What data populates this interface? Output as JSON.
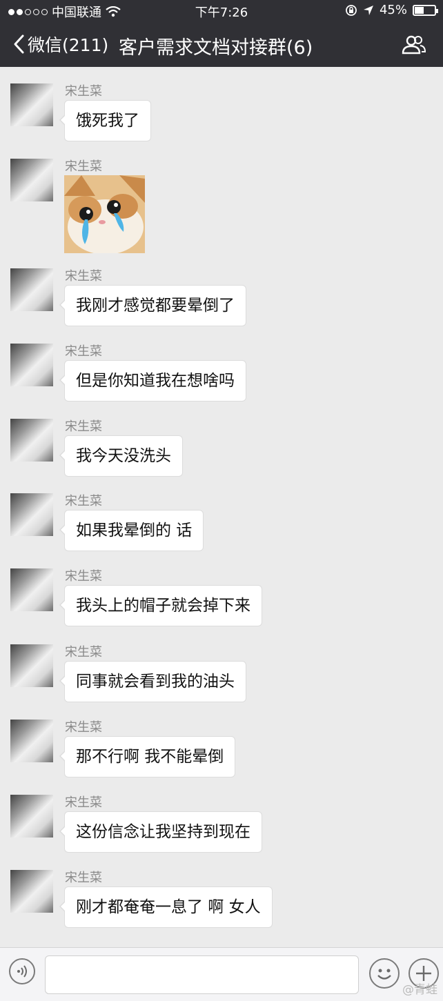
{
  "status_bar": {
    "carrier": "中国联通",
    "time": "下午7:26",
    "battery": "45%",
    "battery_level": 0.45
  },
  "nav": {
    "back_label": "微信(211)",
    "title": "客户需求文档对接群(6)"
  },
  "messages": [
    {
      "sender": "宋生菜",
      "text": "饿死我了"
    },
    {
      "sender": "宋生菜",
      "sticker": "crying-cat-sticker"
    },
    {
      "sender": "宋生菜",
      "text": "我刚才感觉都要晕倒了"
    },
    {
      "sender": "宋生菜",
      "text": "但是你知道我在想啥吗"
    },
    {
      "sender": "宋生菜",
      "text": "我今天没洗头"
    },
    {
      "sender": "宋生菜",
      "text": "如果我晕倒的 话"
    },
    {
      "sender": "宋生菜",
      "text": "我头上的帽子就会掉下来"
    },
    {
      "sender": "宋生菜",
      "text": "同事就会看到我的油头"
    },
    {
      "sender": "宋生菜",
      "text": "那不行啊  我不能晕倒"
    },
    {
      "sender": "宋生菜",
      "text": "这份信念让我坚持到现在"
    },
    {
      "sender": "宋生菜",
      "text": "刚才都奄奄一息了  啊 女人"
    }
  ],
  "watermark": "@青蛙",
  "colors": {
    "header_bg": "#303035",
    "chat_bg": "#ebebeb",
    "bubble_bg": "#ffffff"
  }
}
